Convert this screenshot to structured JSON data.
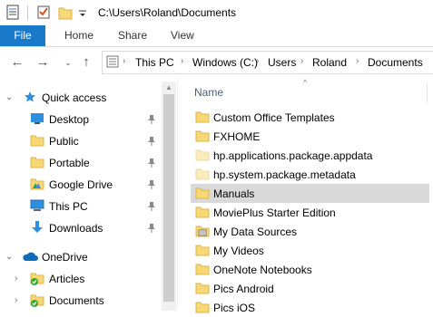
{
  "window": {
    "title_path": "C:\\Users\\Roland\\Documents"
  },
  "ribbon": {
    "tabs": [
      "File",
      "Home",
      "Share",
      "View"
    ]
  },
  "address": {
    "crumbs": [
      "This PC",
      "Windows (C:)",
      "Users",
      "Roland",
      "Documents"
    ]
  },
  "nav": {
    "quick_access": "Quick access",
    "items": [
      {
        "label": "Desktop",
        "icon": "desktop-icon"
      },
      {
        "label": "Public",
        "icon": "folder-icon"
      },
      {
        "label": "Portable",
        "icon": "folder-icon"
      },
      {
        "label": "Google Drive",
        "icon": "folder-drive-icon"
      },
      {
        "label": "This PC",
        "icon": "computer-icon"
      },
      {
        "label": "Downloads",
        "icon": "download-icon"
      }
    ],
    "onedrive": "OneDrive",
    "onedrive_items": [
      {
        "label": "Articles",
        "icon": "folder-sync-icon"
      },
      {
        "label": "Documents",
        "icon": "folder-sync-icon"
      }
    ]
  },
  "content": {
    "column_name": "Name",
    "files": [
      {
        "name": "Custom Office Templates",
        "type": "folder"
      },
      {
        "name": "FXHOME",
        "type": "folder"
      },
      {
        "name": "hp.applications.package.appdata",
        "type": "folder-faded"
      },
      {
        "name": "hp.system.package.metadata",
        "type": "folder-faded"
      },
      {
        "name": "Manuals",
        "type": "folder",
        "selected": true
      },
      {
        "name": "MoviePlus Starter Edition",
        "type": "folder"
      },
      {
        "name": "My Data Sources",
        "type": "folder-data"
      },
      {
        "name": "My Videos",
        "type": "folder"
      },
      {
        "name": "OneNote Notebooks",
        "type": "folder"
      },
      {
        "name": "Pics Android",
        "type": "folder"
      },
      {
        "name": "Pics iOS",
        "type": "folder"
      }
    ]
  },
  "colors": {
    "accent": "#1979ca",
    "folder": "#f8d775",
    "folder_faded": "#fcebbd",
    "selection": "#d9d9d9"
  }
}
